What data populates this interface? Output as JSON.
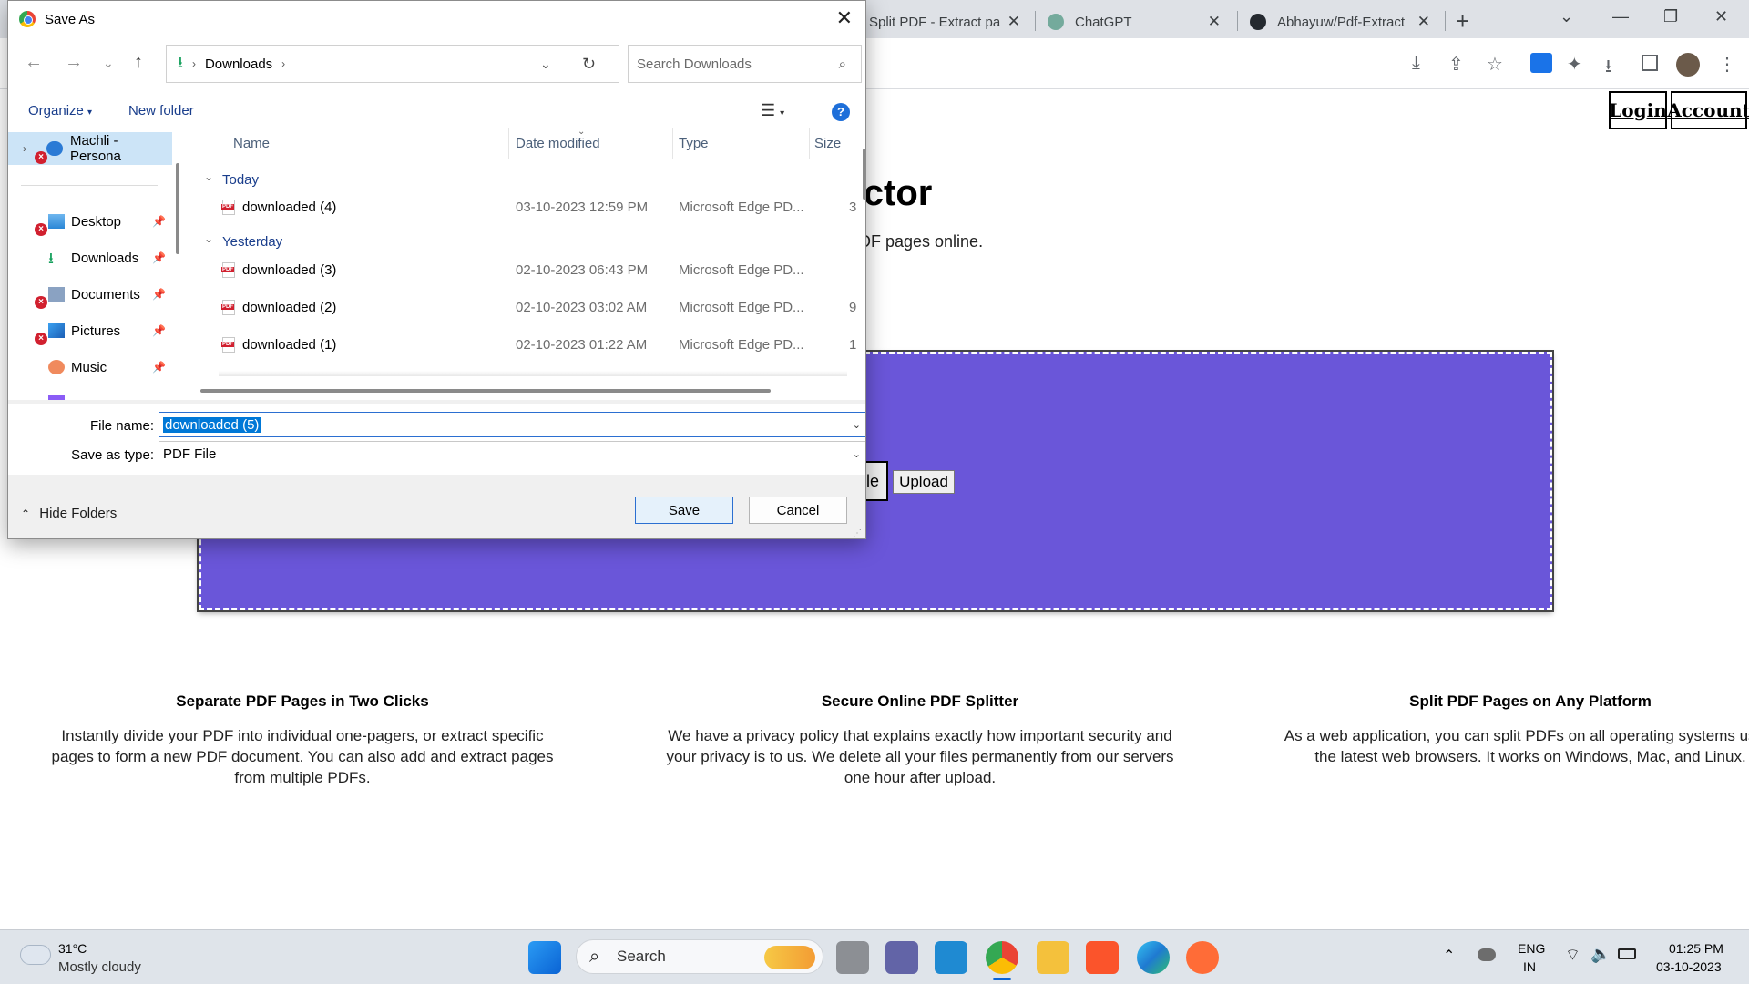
{
  "browser": {
    "tabs": [
      {
        "title": "Split PDF - Extract pa"
      },
      {
        "title": "ChatGPT"
      },
      {
        "title": "Abhayuw/Pdf-Extract"
      }
    ],
    "tab_close": "✕",
    "newtab": "+"
  },
  "page": {
    "nav": {
      "login": "Login",
      "account": "Account"
    },
    "hero_title": "tractor",
    "hero_sub": "d separate PDF pages online.",
    "file_button": "le",
    "upload_button": "Upload",
    "features": [
      {
        "title": "Separate PDF Pages in Two Clicks",
        "text": "Instantly divide your PDF into individual one-pagers, or extract specific pages to form a new PDF document. You can also add and extract pages from multiple PDFs."
      },
      {
        "title": "Secure Online PDF Splitter",
        "text": "We have a privacy policy that explains exactly how important security and your privacy is to us. We delete all your files permanently from our servers one hour after upload."
      },
      {
        "title": "Split PDF Pages on Any Platform",
        "text": "As a web application, you can split PDFs on all operating systems using the latest web browsers. It works on Windows, Mac, and Linux."
      }
    ],
    "colors": {
      "dropzone": "#6a56d9"
    }
  },
  "dialog": {
    "title": "Save As",
    "close": "✕",
    "breadcrumb": {
      "location": "Downloads"
    },
    "search_placeholder": "Search Downloads",
    "cmd": {
      "organize": "Organize",
      "new_folder": "New folder",
      "help": "?"
    },
    "nav_pane": [
      {
        "label": "Machli - Persona"
      },
      {
        "label": "Desktop"
      },
      {
        "label": "Downloads"
      },
      {
        "label": "Documents"
      },
      {
        "label": "Pictures"
      },
      {
        "label": "Music"
      }
    ],
    "columns": {
      "name": "Name",
      "date": "Date modified",
      "type": "Type",
      "size": "Size"
    },
    "groups": {
      "today": "Today",
      "yesterday": "Yesterday"
    },
    "files": [
      {
        "name": "downloaded (4)",
        "date": "03-10-2023 12:59 PM",
        "type": "Microsoft Edge PD...",
        "size": "3"
      },
      {
        "name": "downloaded (3)",
        "date": "02-10-2023 06:43 PM",
        "type": "Microsoft Edge PD...",
        "size": ""
      },
      {
        "name": "downloaded (2)",
        "date": "02-10-2023 03:02 AM",
        "type": "Microsoft Edge PD...",
        "size": "9"
      },
      {
        "name": "downloaded (1)",
        "date": "02-10-2023 01:22 AM",
        "type": "Microsoft Edge PD...",
        "size": "1"
      }
    ],
    "file_name_label": "File name:",
    "file_name_value": "downloaded (5)",
    "save_type_label": "Save as type:",
    "save_type_value": "PDF File",
    "hide_folders": "Hide Folders",
    "save": "Save",
    "cancel": "Cancel"
  },
  "taskbar": {
    "weather_temp": "31°C",
    "weather_desc": "Mostly cloudy",
    "search": "Search",
    "lang_1": "ENG",
    "lang_2": "IN",
    "time": "01:25 PM",
    "date": "03-10-2023"
  }
}
